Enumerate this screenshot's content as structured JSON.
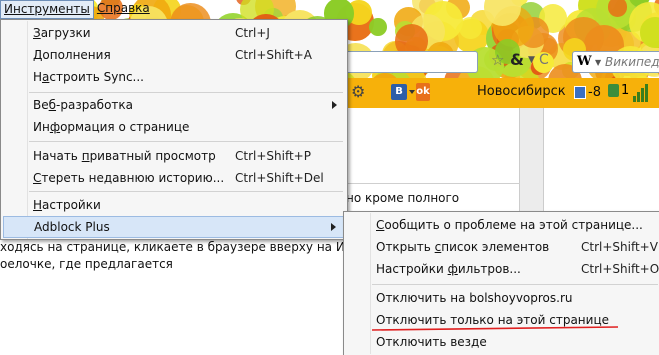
{
  "menubar": {
    "tools": "Инструменты",
    "help": "Справка"
  },
  "tools_menu": [
    {
      "pre": "",
      "u": "З",
      "post": "агрузки",
      "shortcut": "Ctrl+J"
    },
    {
      "pre": "",
      "u": "Д",
      "post": "ополнения",
      "shortcut": "Ctrl+Shift+A"
    },
    {
      "pre": "Н",
      "u": "а",
      "post": "строить Sync...",
      "shortcut": ""
    },
    {
      "pre": "Ве",
      "u": "б",
      "post": "-разработка",
      "shortcut": ""
    },
    {
      "pre": "Ин",
      "u": "ф",
      "post": "ормация о странице",
      "shortcut": ""
    },
    {
      "pre": "Начать ",
      "u": "п",
      "post": "риватный просмотр",
      "shortcut": "Ctrl+Shift+P"
    },
    {
      "pre": "",
      "u": "С",
      "post": "тереть недавнюю историю...",
      "shortcut": "Ctrl+Shift+Del"
    },
    {
      "pre": "",
      "u": "Н",
      "post": "астройки",
      "shortcut": ""
    },
    {
      "pre": "",
      "u": "",
      "post": "Adblock Plus",
      "shortcut": ""
    }
  ],
  "adblock_menu": [
    {
      "pre": "",
      "u": "С",
      "post": "ообщить о проблеме на этой странице...",
      "shortcut": ""
    },
    {
      "pre": "Открыть ",
      "u": "с",
      "post": "писок элементов",
      "shortcut": "Ctrl+Shift+V"
    },
    {
      "pre": "Настройки ",
      "u": "ф",
      "post": "ильтров...",
      "shortcut": "Ctrl+Shift+O"
    },
    {
      "pre": "Отключить на bolshoyvopros.ru",
      "u": "",
      "post": "",
      "shortcut": ""
    },
    {
      "pre": "Отключить только на этой странице",
      "u": "",
      "post": "",
      "shortcut": ""
    },
    {
      "pre": "Отключить везде",
      "u": "",
      "post": "",
      "shortcut": ""
    }
  ],
  "navbar": {
    "search_placeholder": "Википеди",
    "search_engine": "W"
  },
  "bookmarks": {
    "button_b": "B",
    "city": "Новосибирск",
    "temp": "-8",
    "count": "1"
  },
  "page_text": {
    "line1": "но кроме полного",
    "line2": "ходясь на странице, кликаете в браузере вверху на Ино",
    "line3": "оелочке, где предлагается"
  },
  "colors": {
    "menu_bg": "#f6f6f6",
    "highlight": "#d7e6f8",
    "toolbar": "#f7b10a",
    "annotation": "#e02020"
  }
}
